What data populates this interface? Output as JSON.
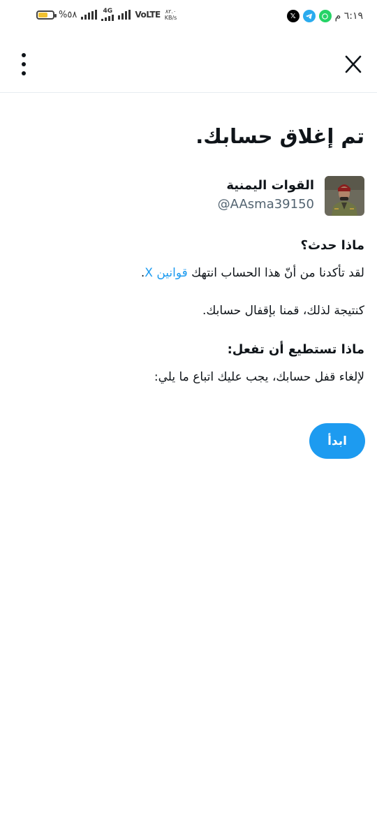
{
  "status_bar": {
    "battery_text": "%٥٨",
    "battery_level": 0.58,
    "network_type": "4G",
    "volte": "VoLTE",
    "speed_value": "٨٢.٠",
    "speed_unit": "KB/s",
    "time": "٦:١٩ م",
    "apps": [
      "x-icon",
      "telegram-icon",
      "whatsapp-icon"
    ]
  },
  "header": {
    "logo": "X",
    "menu": "more-vertical-icon"
  },
  "main": {
    "title": "تم إغلاق حسابك.",
    "profile": {
      "name": "القوات اليمنية",
      "handle": "@AAsma39150"
    },
    "what_happened": {
      "heading": "ماذا حدث؟",
      "text_before_link": "لقد تأكدنا من أنّ هذا الحساب انتهك ",
      "link": "قوانين X",
      "text_after_link": ".",
      "result": "كنتيجة لذلك، قمنا بإقفال حسابك."
    },
    "what_to_do": {
      "heading": "ماذا تستطيع أن تفعل:",
      "text": "لإلغاء قفل حسابك، يجب عليك اتباع ما يلي:"
    },
    "start_button": "ابدأ"
  },
  "colors": {
    "accent": "#1d9bf0",
    "text": "#0f1419",
    "secondary": "#536471"
  }
}
